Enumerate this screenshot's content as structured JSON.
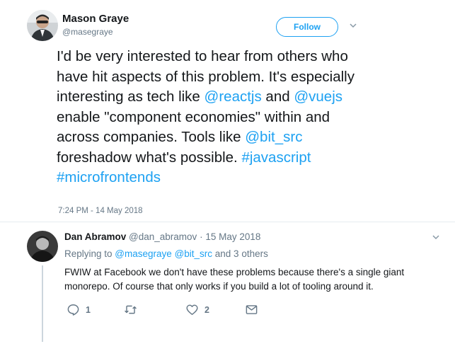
{
  "main_tweet": {
    "author_name": "Mason Graye",
    "author_handle": "@masegraye",
    "follow_label": "Follow",
    "text_1": "I'd be very interested to hear from others who have hit aspects of this problem. It's especially interesting as tech like ",
    "mention_1": "@reactjs",
    "text_2": " and ",
    "mention_2": "@vuejs",
    "text_3": " enable \"component economies\" within and across companies. Tools like ",
    "mention_3": "@bit_src",
    "text_4": " foreshadow what's possible. ",
    "hashtag_1": "#javascript",
    "text_5": " ",
    "hashtag_2": "#microfrontends",
    "timestamp": "7:24 PM - 14 May 2018"
  },
  "reply": {
    "author_name": "Dan Abramov",
    "author_handle": "@dan_abramov",
    "separator": " · ",
    "date": "15 May 2018",
    "replying_prefix": "Replying to ",
    "replying_user_1": "@masegraye",
    "replying_space": " ",
    "replying_user_2": "@bit_src",
    "replying_suffix": " and 3 others",
    "text": "FWIW at Facebook we don't have these problems because there's a single giant monorepo. Of course that only works if you build a lot of tooling around it.",
    "reply_count": "1",
    "retweet_count": "",
    "like_count": "2"
  },
  "colors": {
    "link": "#1da1f2",
    "muted": "#657786",
    "text": "#14171a",
    "divider": "#e6ecf0"
  },
  "icons": {
    "reply": "reply-icon",
    "retweet": "retweet-icon",
    "like": "heart-icon",
    "dm": "envelope-icon",
    "more": "chevron-down-icon"
  }
}
